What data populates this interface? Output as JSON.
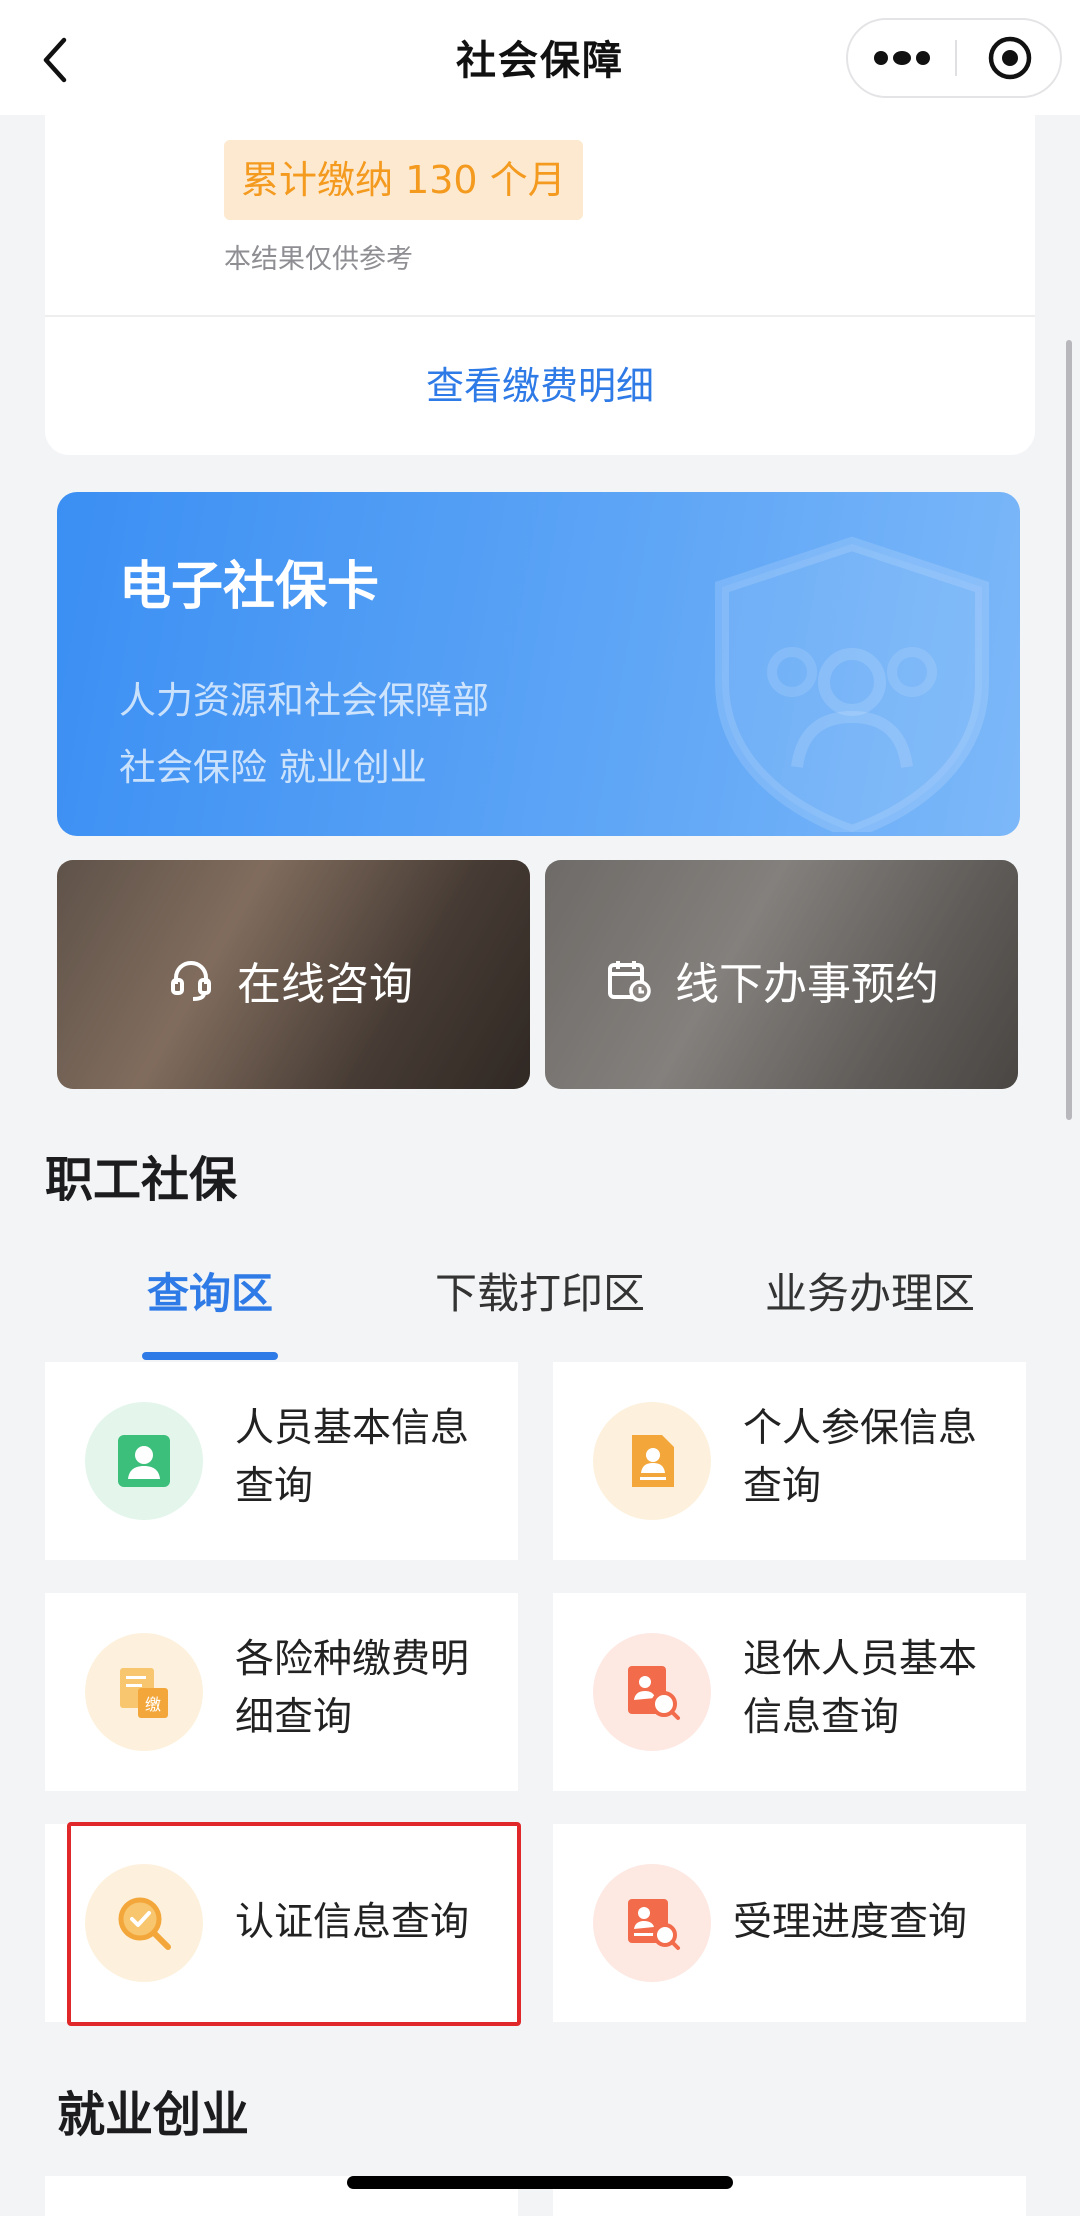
{
  "nav": {
    "title": "社会保障"
  },
  "payment_card": {
    "badge": "累计缴纳 130 个月",
    "note": "本结果仅供参考",
    "link": "查看缴费明细"
  },
  "ssc_card": {
    "title": "电子社保卡",
    "line1": "人力资源和社会保障部",
    "line2": "社会保险   就业创业"
  },
  "tiles": {
    "consult": "在线咨询",
    "appointment": "线下办事预约"
  },
  "section_employee": {
    "title": "职工社保"
  },
  "tabs": [
    {
      "label": "查询区",
      "active": true
    },
    {
      "label": "下载打印区",
      "active": false
    },
    {
      "label": "业务办理区",
      "active": false
    }
  ],
  "services": [
    {
      "label": "人员基本信息查询",
      "icon": "person-card-icon",
      "color": "#3cbf7a"
    },
    {
      "label": "个人参保信息查询",
      "icon": "insured-doc-icon",
      "color": "#f3a73b"
    },
    {
      "label": "各险种缴费明细查询",
      "icon": "payment-doc-icon",
      "color": "#f3a73b"
    },
    {
      "label": "退休人员基本信息查询",
      "icon": "retiree-search-icon",
      "color": "#f26b4b"
    },
    {
      "label": "认证信息查询",
      "icon": "verify-search-icon",
      "color": "#f3a73b"
    },
    {
      "label": "受理进度查询",
      "icon": "progress-search-icon",
      "color": "#f26b4b"
    }
  ],
  "section_employment": {
    "title": "就业创业"
  },
  "colors": {
    "accent": "#2e7ae6",
    "badge_text": "#f39a1f",
    "highlight": "#e0282b"
  }
}
